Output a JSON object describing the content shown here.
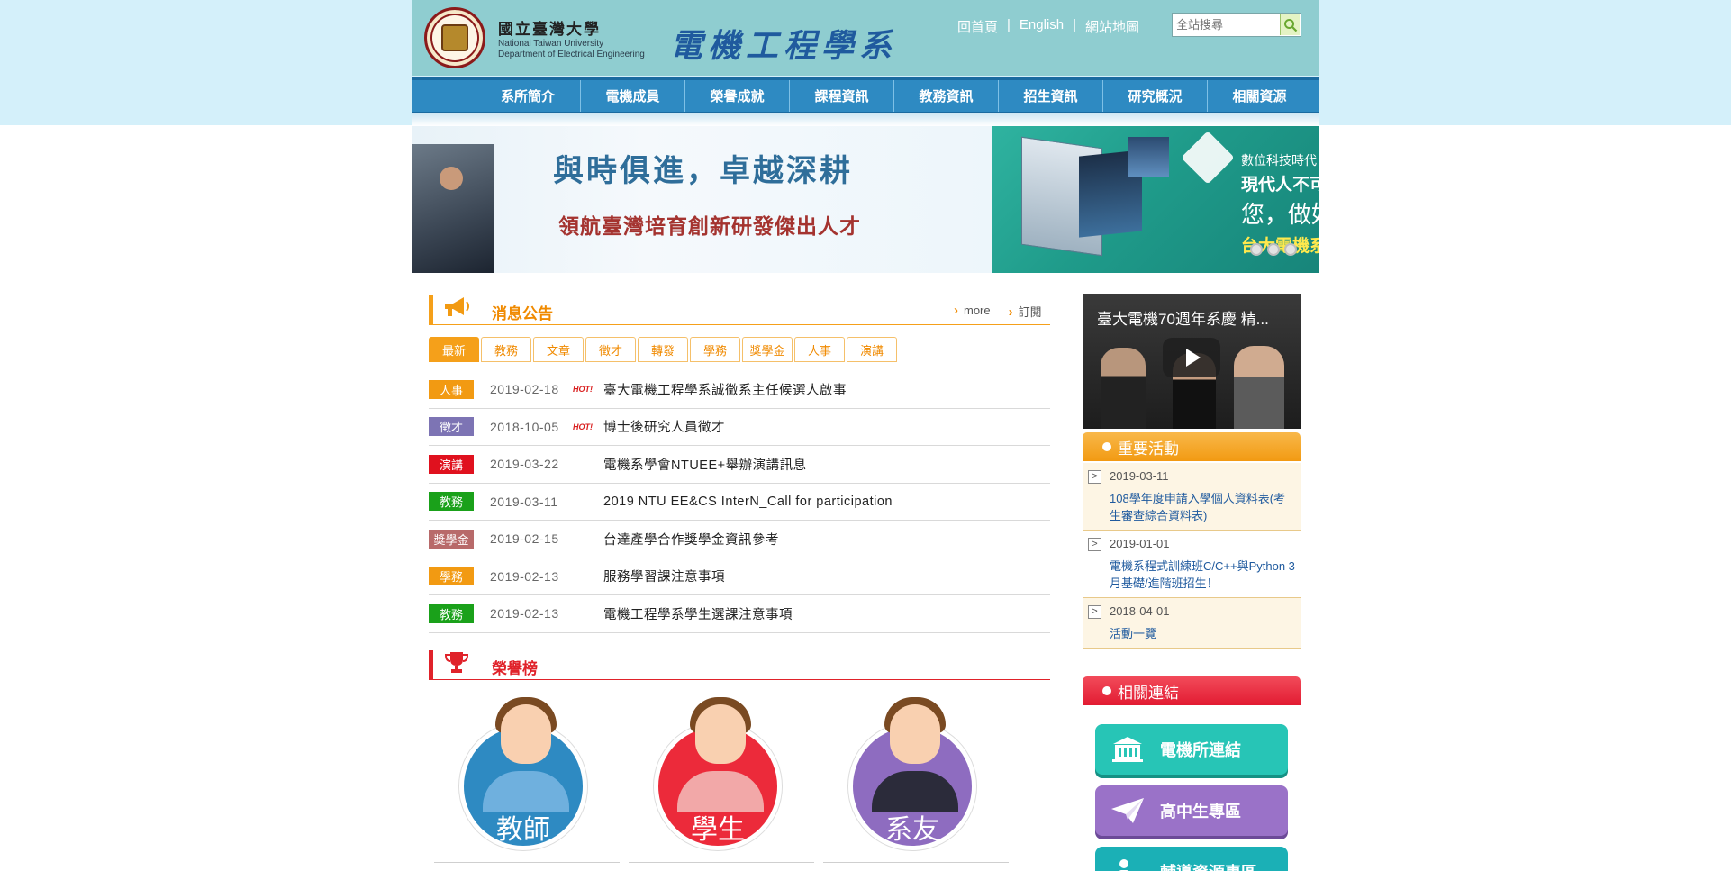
{
  "header": {
    "univ_zh": "國立臺灣大學",
    "univ_en_1": "National Taiwan University",
    "univ_en_2": "Department of Electrical Engineering",
    "dept_zh": "電機工程學系",
    "links": [
      "回首頁",
      "English",
      "網站地圖"
    ],
    "search_placeholder": "全站搜尋"
  },
  "nav": [
    "系所簡介",
    "電機成員",
    "榮譽成就",
    "課程資訊",
    "教務資訊",
    "招生資訊",
    "研究概況",
    "相關資源"
  ],
  "banner": {
    "title": "與時俱進，卓越深耕",
    "subtitle": "領航臺灣培育創新研發傑出人才",
    "right_1": "數位科技時代",
    "right_2": "現代人不可",
    "right_3": "您，做好",
    "right_4": "台大電機系"
  },
  "news": {
    "title": "消息公告",
    "more": "more",
    "subscribe": "訂閱",
    "tabs": [
      "最新",
      "教務",
      "文章",
      "徵才",
      "轉發",
      "學務",
      "獎學金",
      "人事",
      "演講"
    ],
    "hot_label": "HOT!",
    "items": [
      {
        "tag": "人事",
        "color": "#f29a12",
        "date": "2019-02-18",
        "hot": true,
        "title": "臺大電機工程學系誠徵系主任候選人啟事"
      },
      {
        "tag": "徵才",
        "color": "#7d74b4",
        "date": "2018-10-05",
        "hot": true,
        "title": "博士後研究人員徵才"
      },
      {
        "tag": "演講",
        "color": "#e0111e",
        "date": "2019-03-22",
        "hot": false,
        "title": "電機系學會NTUEE+舉辦演講訊息"
      },
      {
        "tag": "教務",
        "color": "#1aa11a",
        "date": "2019-03-11",
        "hot": false,
        "title": "2019 NTU EE&CS InterN_Call for participation"
      },
      {
        "tag": "獎學金",
        "color": "#b86a6a",
        "date": "2019-02-15",
        "hot": false,
        "title": "台達產學合作獎學金資訊參考"
      },
      {
        "tag": "學務",
        "color": "#f29a12",
        "date": "2019-02-13",
        "hot": false,
        "title": "服務學習課注意事項"
      },
      {
        "tag": "教務",
        "color": "#1aa11a",
        "date": "2019-02-13",
        "hot": false,
        "title": "電機工程學系學生選課注意事項"
      }
    ]
  },
  "honor": {
    "title": "榮譽榜",
    "people": [
      {
        "label": "教師",
        "color": "#2e8ac2",
        "body": "#6fb0de"
      },
      {
        "label": "學生",
        "color": "#ec2a3a",
        "body": "#f2a8a8"
      },
      {
        "label": "系友",
        "color": "#8e6cc0",
        "body": "#2b2b3a"
      }
    ]
  },
  "video": {
    "title": "臺大電機70週年系慶 精..."
  },
  "events": {
    "title": "重要活動",
    "items": [
      {
        "date": "2019-03-11",
        "title": "108學年度申請入學個人資料表(考生審查綜合資料表)"
      },
      {
        "date": "2019-01-01",
        "title": "電機系程式訓練班C/C++與Python 3月基礎/進階班招生！"
      },
      {
        "date": "2018-04-01",
        "title": "活動一覽"
      }
    ]
  },
  "links": {
    "title": "相關連結",
    "buttons": [
      "電機所連結",
      "高中生專區",
      "輔導資源專區"
    ]
  },
  "colors": {
    "header_bg": "#8fcdd0",
    "nav_bg": "#2e8ac2",
    "news_accent": "#f08a00",
    "honor_accent": "#e0222a"
  }
}
